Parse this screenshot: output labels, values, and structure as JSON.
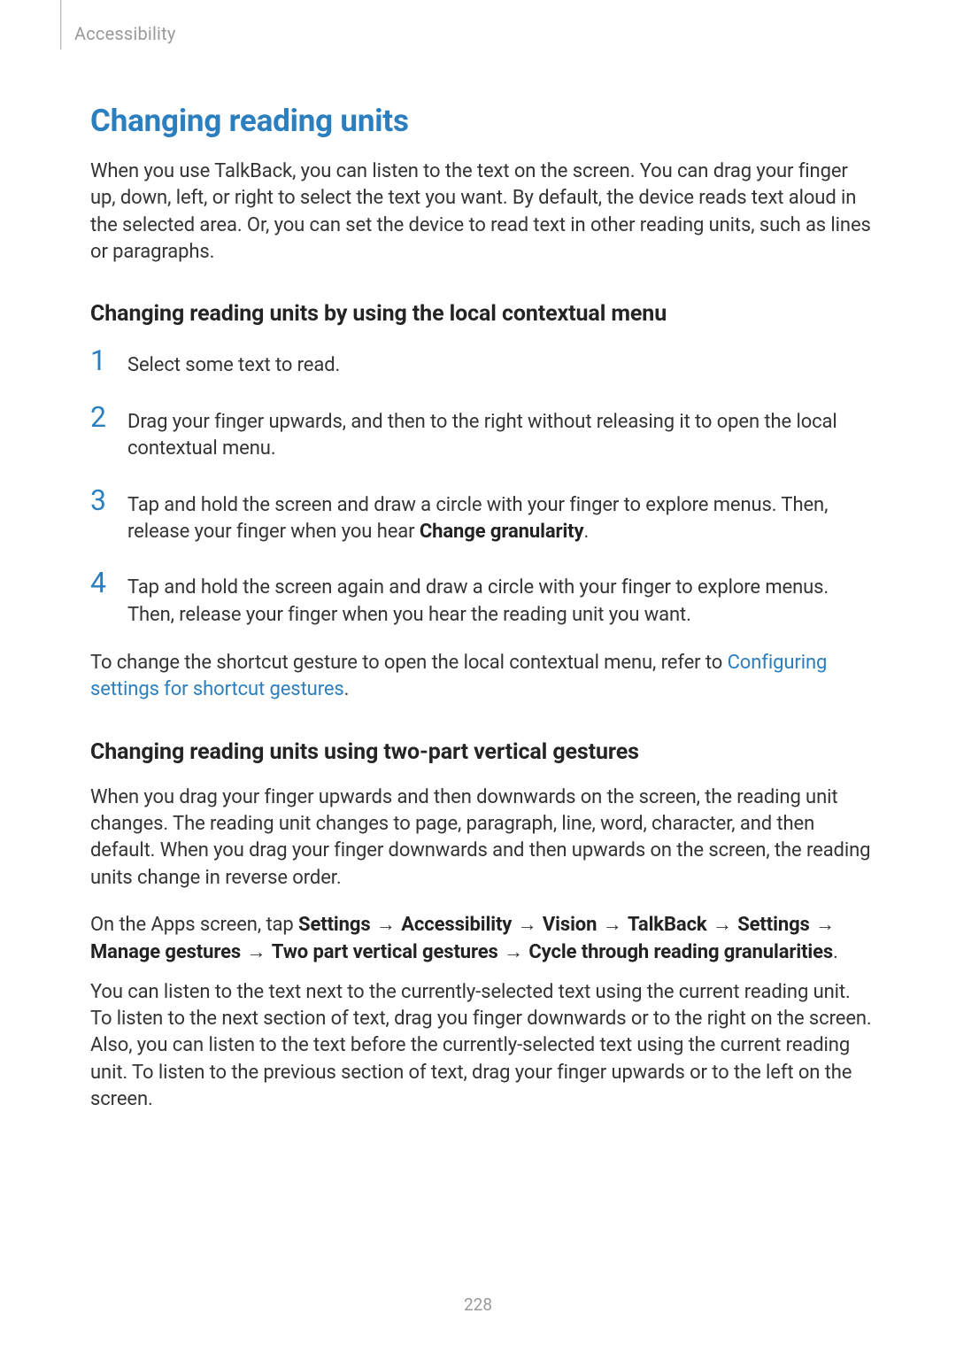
{
  "header": {
    "section": "Accessibility"
  },
  "h1": "Changing reading units",
  "intro": "When you use TalkBack, you can listen to the text on the screen. You can drag your finger up, down, left, or right to select the text you want. By default, the device reads text aloud in the selected area. Or, you can set the device to read text in other reading units, such as lines or paragraphs.",
  "sectionA": {
    "title": "Changing reading units by using the local contextual menu",
    "steps": {
      "s1": {
        "num": "1",
        "text": "Select some text to read."
      },
      "s2": {
        "num": "2",
        "text": "Drag your finger upwards, and then to the right without releasing it to open the local contextual menu."
      },
      "s3": {
        "num": "3",
        "pre": "Tap and hold the screen and draw a circle with your finger to explore menus. Then, release your finger when you hear ",
        "bold": "Change granularity",
        "post": "."
      },
      "s4": {
        "num": "4",
        "text": "Tap and hold the screen again and draw a circle with your finger to explore menus. Then, release your finger when you hear the reading unit you want."
      }
    },
    "note": {
      "pre": "To change the shortcut gesture to open the local contextual menu, refer to ",
      "link": "Configuring settings for shortcut gestures",
      "post": "."
    }
  },
  "sectionB": {
    "title": "Changing reading units using two-part vertical gestures",
    "para1": "When you drag your finger upwards and then downwards on the screen, the reading unit changes. The reading unit changes to page, paragraph, line, word, character, and then default. When you drag your finger downwards and then upwards on the screen, the reading units change in reverse order.",
    "path": {
      "lead": "On the Apps screen, tap ",
      "p1": "Settings",
      "p2": "Accessibility",
      "p3": "Vision",
      "p4": "TalkBack",
      "p5": "Settings",
      "p6": "Manage gestures",
      "p7": "Two part vertical gestures",
      "p8": "Cycle through reading granularities",
      "end": "."
    },
    "arrow": "→",
    "para2": "You can listen to the text next to the currently-selected text using the current reading unit. To listen to the next section of text, drag you finger downwards or to the right on the screen. Also, you can listen to the text before the currently-selected text using the current reading unit. To listen to the previous section of text, drag your finger upwards or to the left on the screen."
  },
  "pageNumber": "228"
}
